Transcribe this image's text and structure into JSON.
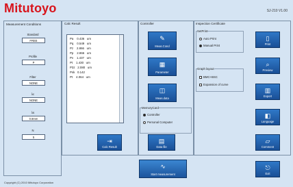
{
  "app": {
    "logo": "Mitutoyo",
    "version": "SJ-210 V1.00"
  },
  "measurement_conditions": {
    "title": "Measurement Conditions",
    "fields": [
      {
        "label": "Standard",
        "value": "FREE"
      },
      {
        "label": "Profile",
        "value": "P"
      },
      {
        "label": "Filter",
        "value": "NONE"
      },
      {
        "label": "λc",
        "value": "NONE"
      },
      {
        "label": "λs",
        "value": "0.8mm"
      },
      {
        "label": "N",
        "value": "5"
      }
    ]
  },
  "calc_result": {
    "title": "Calc Result",
    "rows": [
      "Pa    0.436   um",
      "Pq    0.549   um",
      "Pz    2.866   um",
      "Pp    2.866   um",
      "Pv    1.437   um",
      "Pt    1.430   um",
      "P3z   2.080   um",
      "Psk   0.142",
      "Pt    4.064   um"
    ],
    "button_label": "Calc Result"
  },
  "controller": {
    "title": "Controller",
    "buttons": [
      {
        "label": "Meas.Cond",
        "icon": "pencil-icon"
      },
      {
        "label": "Parameter",
        "icon": "parameter-icon"
      },
      {
        "label": "Meas.data",
        "icon": "chart-icon"
      }
    ],
    "memory_card": {
      "title": "MemoryCard",
      "options": [
        {
          "label": "Controller",
          "selected": true
        },
        {
          "label": "Personal Computer",
          "selected": false
        }
      ],
      "button_label": "Data file"
    }
  },
  "inspection_certificate": {
    "title": "Inspection Certificate",
    "set_print": {
      "title": "SetPrint",
      "options": [
        {
          "label": "Auto Print",
          "selected": false
        },
        {
          "label": "Manual Print",
          "selected": true
        }
      ]
    },
    "graph_layout": {
      "title": "Graph layout",
      "options": [
        {
          "label": "BMC+BSC",
          "checked": false
        },
        {
          "label": "Expansion of curve",
          "checked": false
        }
      ]
    }
  },
  "side_buttons": [
    {
      "label": "Print",
      "icon": "print-icon"
    },
    {
      "label": "Preview",
      "icon": "preview-icon"
    },
    {
      "label": "Export",
      "icon": "export-icon"
    },
    {
      "label": "Language",
      "icon": "language-icon"
    },
    {
      "label": "Comment",
      "icon": "comment-icon"
    },
    {
      "label": "Exit",
      "icon": "exit-icon"
    }
  ],
  "start_button": {
    "label": "Start measurement"
  },
  "footer": {
    "copyright": "Copyright (C) 2010 Mitutoyo Corporation"
  }
}
